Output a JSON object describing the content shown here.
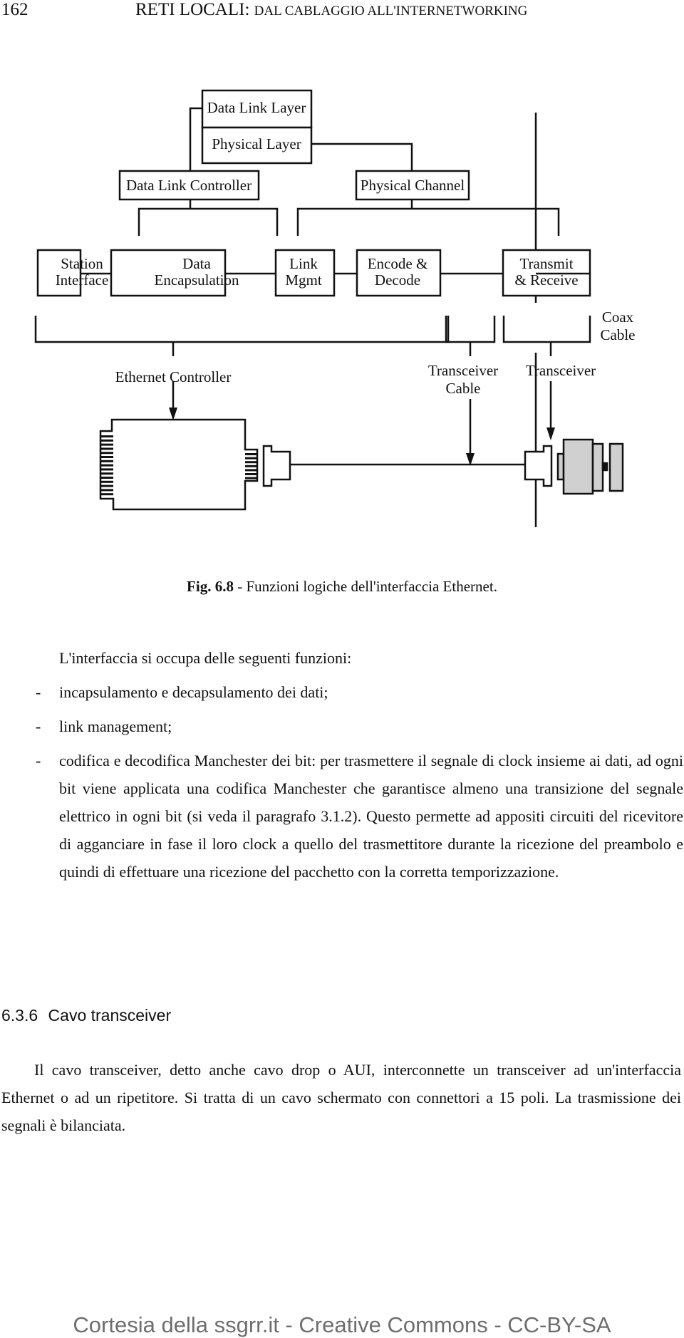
{
  "header": {
    "page_number": "162",
    "running_title_main": "RETI LOCALI:",
    "running_title_rest": "DAL CABLAGGIO ALL'INTERNETWORKING"
  },
  "figure": {
    "boxes": {
      "data_link_layer": "Data Link Layer",
      "physical_layer": "Physical Layer",
      "data_link_controller": "Data Link Controller",
      "physical_channel": "Physical Channel",
      "station_interface": [
        "Station",
        "Interface"
      ],
      "data_encapsulation": [
        "Data",
        "Encapsulation"
      ],
      "link_mgmt": [
        "Link",
        "Mgmt"
      ],
      "encode_decode": [
        "Encode &",
        "Decode"
      ],
      "transmit_receive": [
        "Transmit",
        "& Receive"
      ]
    },
    "labels": {
      "coax_cable": [
        "Coax",
        "Cable"
      ],
      "ethernet_controller": "Ethernet Controller",
      "transceiver_cable": [
        "Transceiver",
        "Cable"
      ],
      "transceiver": "Transceiver"
    },
    "caption_number": "Fig. 6.8",
    "caption_text": " - Funzioni logiche dell'interfaccia Ethernet."
  },
  "body": {
    "intro": "L'interfaccia si occupa delle seguenti funzioni:",
    "bullets": [
      "incapsulamento e decapsulamento dei dati;",
      "link management;",
      "codifica e decodifica Manchester dei bit: per trasmettere il segnale di clock insieme ai dati, ad ogni bit viene applicata una codifica Manchester che garantisce almeno una transizione del segnale elettrico in ogni bit (si veda il paragrafo 3.1.2). Questo permette ad appositi circuiti del ricevitore di agganciare in fase il loro clock a quello del trasmettitore durante la ricezione del preambolo e quindi di effettuare una ricezione del pacchetto con la corretta temporizzazione."
    ],
    "bullet_marker": "-"
  },
  "section": {
    "number": "6.3.6",
    "title": "Cavo transceiver",
    "paragraph": "Il cavo transceiver, detto anche cavo drop o AUI, interconnette un transceiver ad un'interfaccia Ethernet o ad un ripetitore. Si tratta di un cavo schermato con connettori a 15 poli. La trasmissione dei segnali è bilanciata."
  },
  "footer": {
    "credit": "Cortesia della ssgrr.it - Creative Commons - CC-BY-SA"
  },
  "colors": {
    "ink": "#111111",
    "device_fill": "#d0d0d0",
    "footer_text": "#6e6e6e"
  }
}
